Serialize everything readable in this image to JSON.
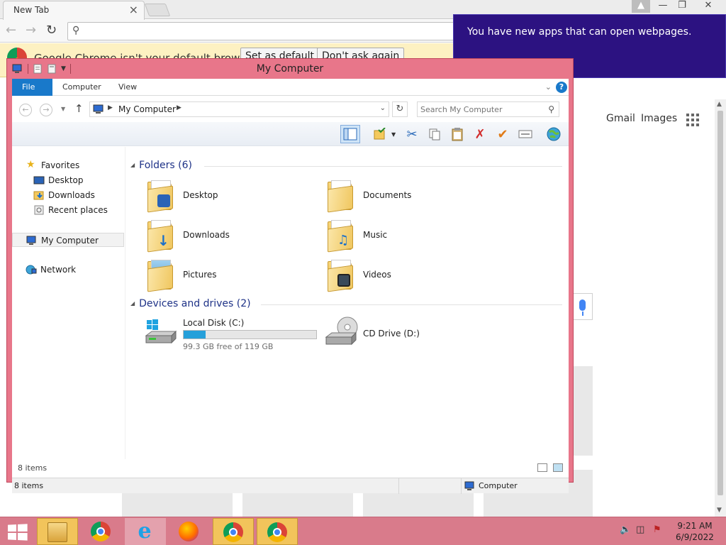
{
  "chrome": {
    "tab_title": "New Tab",
    "tab_close": "×",
    "infobar_message": "Google Chrome isn't your default browser",
    "set_default_label": "Set as default",
    "dont_ask_label": "Don't ask again",
    "gmail_label": "Gmail",
    "images_label": "Images"
  },
  "toast": {
    "message": "You have new apps that can open webpages."
  },
  "explorer": {
    "window_title": "My Computer",
    "ribbon_tabs": [
      "File",
      "Computer",
      "View"
    ],
    "address_path": "My Computer",
    "search_placeholder": "Search My Computer",
    "navpane": {
      "favorites": "Favorites",
      "desktop": "Desktop",
      "downloads": "Downloads",
      "recent": "Recent places",
      "computer": "My Computer",
      "network": "Network"
    },
    "folders_header": "Folders (6)",
    "folders": [
      "Desktop",
      "Documents",
      "Downloads",
      "Music",
      "Pictures",
      "Videos"
    ],
    "drives_header": "Devices and drives (2)",
    "drives": [
      {
        "name": "Local Disk (C:)",
        "free_text": "99.3 GB free of 119 GB",
        "used_fraction": 0.166
      },
      {
        "name": "CD Drive (D:)"
      }
    ],
    "item_count": "8 items",
    "status_count": "8 items",
    "status_location": "Computer"
  },
  "taskbar": {
    "clock_time": "9:21 AM",
    "clock_date": "6/9/2022"
  },
  "colors": {
    "window_frame": "#e8768a",
    "ribbon_file": "#1979ca",
    "toast_bg": "#2c1281",
    "taskbar": "#d97b8b",
    "active_task": "#f2c45b",
    "drive_bar": "#26a0da"
  }
}
